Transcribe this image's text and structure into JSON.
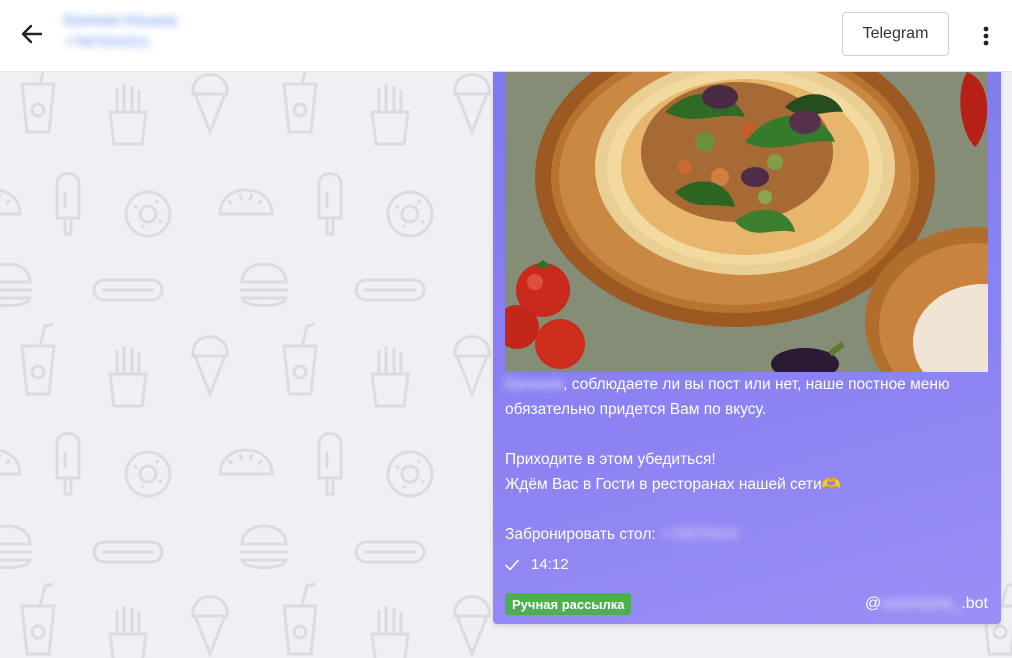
{
  "header": {
    "contact_name": "Евгения Ильина",
    "contact_phone": "+79876543211",
    "channel_label": "Telegram",
    "icons": {
      "back": "arrow-left-icon",
      "menu": "more-vertical-icon"
    }
  },
  "message": {
    "recipient_name": "Евгения",
    "line1": ", соблюдаете ли вы пост или нет, наше постное меню обязательно придется Вам по вкусу.",
    "line2": "Приходите в этом убедиться!",
    "line3": "Ждём Вас в Гости в ресторанах нашей сети🫶",
    "booking_label": "Забронировать стол:",
    "booking_phone": "+79876543",
    "time": "14:12",
    "status_icon": "check-icon",
    "badge": "Ручная рассылка",
    "bot_prefix": "@",
    "bot_hidden": "username_",
    "bot_suffix": ".bot"
  },
  "colors": {
    "bubble": "#8a82f2",
    "badge": "#4caf50",
    "background": "#f0eff4",
    "doodle": "#e2e1e8"
  }
}
